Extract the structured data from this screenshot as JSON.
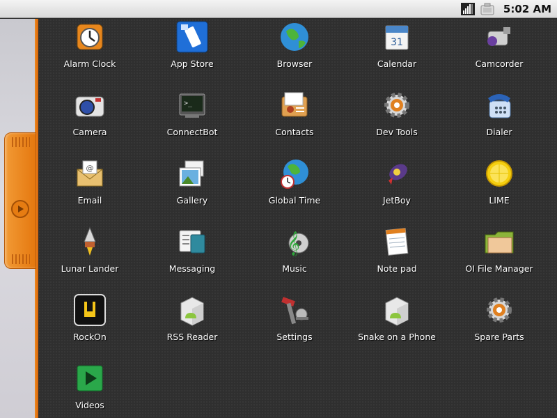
{
  "status_bar": {
    "time": "5:02 AM",
    "icons": [
      "signal-icon",
      "battery-icon"
    ]
  },
  "apps": [
    {
      "label": "Alarm Clock",
      "icon": "alarm-clock-icon"
    },
    {
      "label": "App Store",
      "icon": "app-store-icon"
    },
    {
      "label": "Browser",
      "icon": "browser-icon"
    },
    {
      "label": "Calendar",
      "icon": "calendar-icon"
    },
    {
      "label": "Camcorder",
      "icon": "camcorder-icon"
    },
    {
      "label": "Camera",
      "icon": "camera-icon"
    },
    {
      "label": "ConnectBot",
      "icon": "terminal-icon"
    },
    {
      "label": "Contacts",
      "icon": "contacts-icon"
    },
    {
      "label": "Dev Tools",
      "icon": "gear-icon"
    },
    {
      "label": "Dialer",
      "icon": "phone-icon"
    },
    {
      "label": "Email",
      "icon": "email-icon"
    },
    {
      "label": "Gallery",
      "icon": "gallery-icon"
    },
    {
      "label": "Global Time",
      "icon": "globe-clock-icon"
    },
    {
      "label": "JetBoy",
      "icon": "rocket-icon"
    },
    {
      "label": "LIME",
      "icon": "lime-icon"
    },
    {
      "label": "Lunar Lander",
      "icon": "lander-icon"
    },
    {
      "label": "Messaging",
      "icon": "messaging-icon"
    },
    {
      "label": "Music",
      "icon": "music-icon"
    },
    {
      "label": "Note pad",
      "icon": "notepad-icon"
    },
    {
      "label": "OI File Manager",
      "icon": "folder-icon"
    },
    {
      "label": "RockOn",
      "icon": "rockon-icon"
    },
    {
      "label": "RSS Reader",
      "icon": "android-box-icon"
    },
    {
      "label": "Settings",
      "icon": "settings-icon"
    },
    {
      "label": "Snake on a Phone",
      "icon": "android-box-icon"
    },
    {
      "label": "Spare Parts",
      "icon": "gear-icon"
    },
    {
      "label": "Videos",
      "icon": "play-icon"
    }
  ]
}
